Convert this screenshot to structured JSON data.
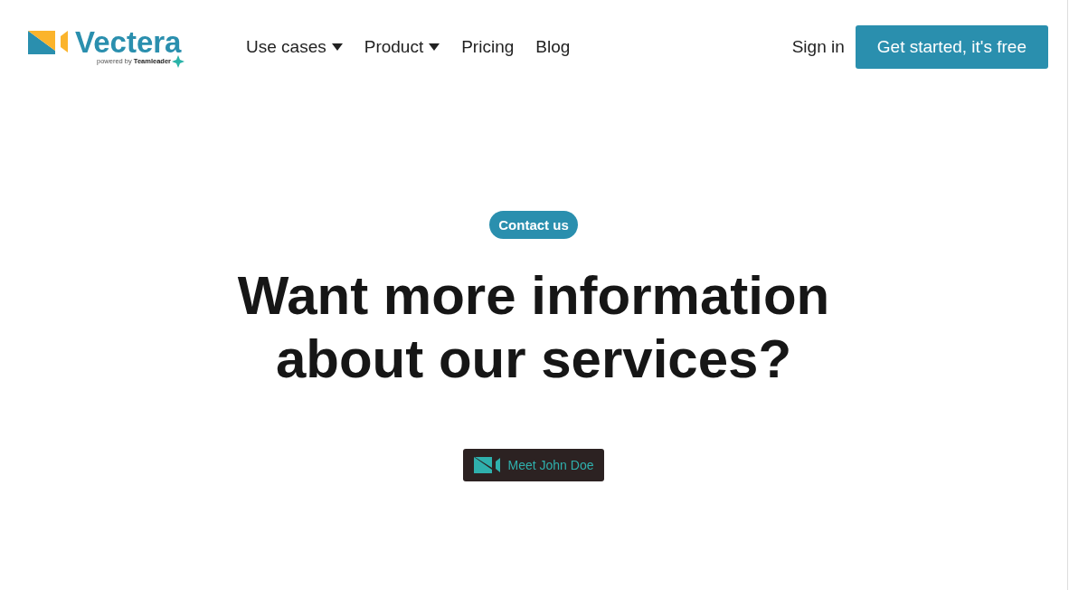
{
  "logo": {
    "name": "Vectera",
    "tagline_prefix": "powered by",
    "tagline_brand": "Teamleader"
  },
  "nav": [
    {
      "label": "Use cases",
      "dropdown": true
    },
    {
      "label": "Product",
      "dropdown": true
    },
    {
      "label": "Pricing",
      "dropdown": false
    },
    {
      "label": "Blog",
      "dropdown": false
    }
  ],
  "sign_in": "Sign in",
  "cta": "Get started, it's free",
  "hero": {
    "badge": "Contact us",
    "title_lines": [
      "Want more information",
      "about our services?"
    ],
    "meeting_button": "Meet John Doe"
  }
}
